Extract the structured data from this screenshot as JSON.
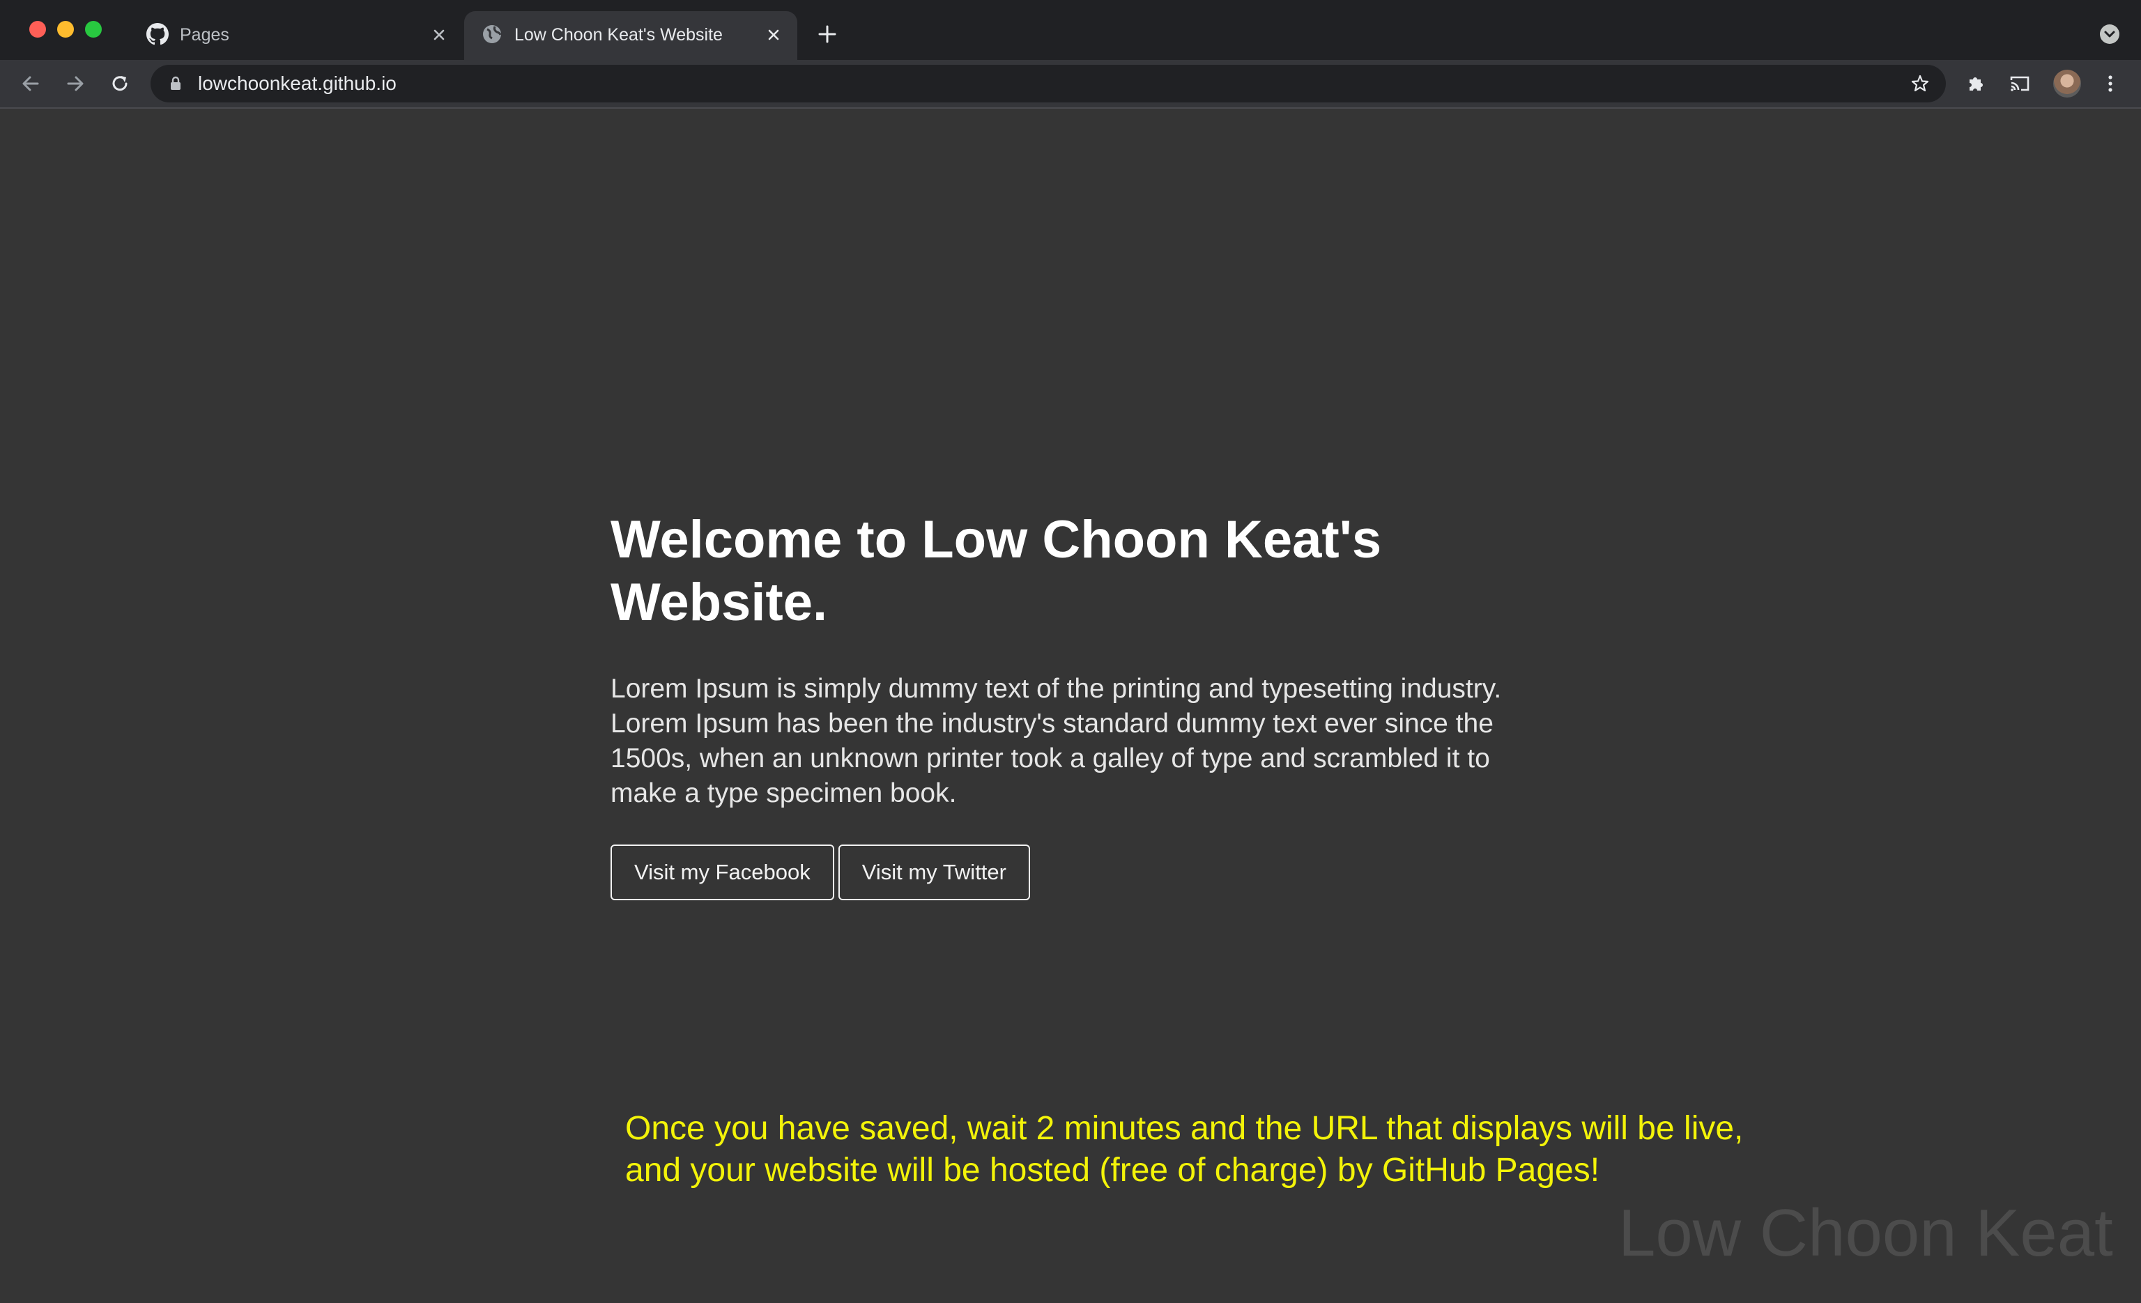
{
  "browser": {
    "tabs": [
      {
        "title": "Pages",
        "favicon": "github-icon",
        "active": false
      },
      {
        "title": "Low Choon Keat's Website",
        "favicon": "globe-icon",
        "active": true
      }
    ],
    "address_bar": {
      "url": "lowchoonkeat.github.io"
    }
  },
  "page": {
    "heading": "Welcome to Low Choon Keat's Website.",
    "lead": "Lorem Ipsum is simply dummy text of the printing and typesetting industry. Lorem Ipsum has been the industry's standard dummy text ever since the 1500s, when an unknown printer took a galley of type and scrambled it to make a type specimen book.",
    "buttons": {
      "facebook": "Visit my Facebook",
      "twitter": "Visit my Twitter"
    }
  },
  "overlay": {
    "caption": "Once you have saved, wait 2 minutes and the URL that displays will be live, and your website will be hosted (free of charge) by GitHub Pages!",
    "watermark": "Low Choon Keat"
  },
  "colors": {
    "page_background": "#353535",
    "caption": "#f3f309",
    "tab_strip": "#202124",
    "toolbar": "#35363a"
  }
}
